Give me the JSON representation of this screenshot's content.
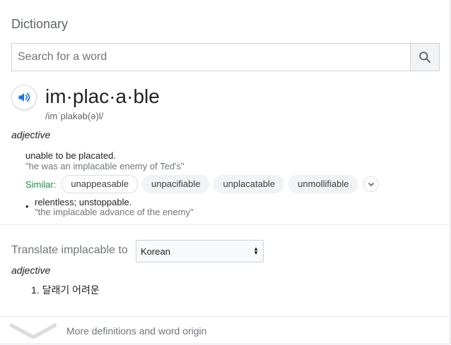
{
  "header": {
    "title": "Dictionary"
  },
  "search": {
    "placeholder": "Search for a word",
    "value": ""
  },
  "entry": {
    "word": "im·plac·a·ble",
    "phonetic": "/imˈplakəb(ə)l/",
    "part_of_speech": "adjective",
    "definitions": [
      {
        "text": "unable to be placated.",
        "example": "\"he was an implacable enemy of Ted's\"",
        "similar_label": "Similar:",
        "similar": [
          "unappeasable",
          "unpacifiable",
          "unplacatable",
          "unmollifiable"
        ]
      },
      {
        "text": "relentless; unstoppable.",
        "example": "\"the implacable advance of the enemy\""
      }
    ]
  },
  "translate": {
    "label": "Translate implacable to",
    "language": "Korean",
    "part_of_speech": "adjective",
    "items": [
      "1. 달래기 어려운"
    ]
  },
  "footer": {
    "more_label": "More definitions and word origin"
  },
  "colors": {
    "similar_green": "#1e8e3e",
    "icon_blue": "#1a73e8",
    "muted": "#70757a"
  },
  "icons": {
    "search": "search-icon",
    "speaker": "speaker-icon",
    "expand": "chevron-down-icon",
    "more": "chevron-down-icon"
  }
}
